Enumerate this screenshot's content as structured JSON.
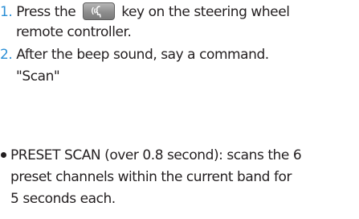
{
  "colors": {
    "step_number": "#2b8fd6",
    "text": "#231f20"
  },
  "icons": {
    "voice_key": "voice-recognition-key-icon"
  },
  "steps": [
    {
      "number": "1.",
      "text_before_icon": "Press the",
      "text_after_icon": "key on the steering wheel",
      "continuation": "remote controller."
    },
    {
      "number": "2.",
      "text": "After the beep sound, say a command.",
      "command": "\"Scan\""
    }
  ],
  "note": {
    "line1": "PRESET SCAN (over 0.8 second): scans the 6",
    "line2": "preset channels within the current band for",
    "line3": "5 seconds each."
  }
}
